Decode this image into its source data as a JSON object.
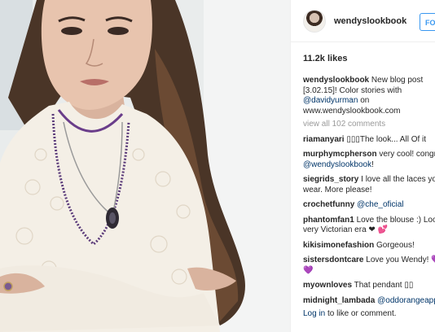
{
  "post": {
    "username": "wendyslookbook",
    "follow_label": "FOLLOW",
    "likes": "11.2k likes"
  },
  "caption": {
    "user": "wendyslookbook",
    "text1": "New blog post",
    "text2": "[3.02.15]! Color stories with",
    "mention": "@davidyurman",
    "text3": "on",
    "text4": "www.wendyslookbook.com"
  },
  "view_all": "view all 102 comments",
  "comments": [
    {
      "user": "riamanyari",
      "lines": [
        "▯▯▯The look... All Of it"
      ]
    },
    {
      "user": "murphymcpherson",
      "lines": [
        "very cool! congr"
      ],
      "mention": "@wendyslookbook",
      "after_mention": "!"
    },
    {
      "user": "siegrids_story",
      "lines": [
        "I love all the laces you",
        "wear. More please!"
      ]
    },
    {
      "user": "crochetfunny",
      "mention": "@che_oficial"
    },
    {
      "user": "phantomfan1",
      "lines": [
        "Love the blouse :) Loo",
        "very Victorian era ❤ 💕"
      ]
    },
    {
      "user": "kikisimonefashion",
      "lines": [
        "Gorgeous!"
      ]
    },
    {
      "user": "sistersdontcare",
      "lines": [
        "Love you Wendy! 💜",
        "💜"
      ]
    },
    {
      "user": "myownloves",
      "lines": [
        "That pendant ▯▯"
      ]
    },
    {
      "user": "midnight_lambada",
      "mention": "@oddorangeapp"
    }
  ],
  "login": {
    "link": "Log in",
    "rest": "to like or comment."
  }
}
